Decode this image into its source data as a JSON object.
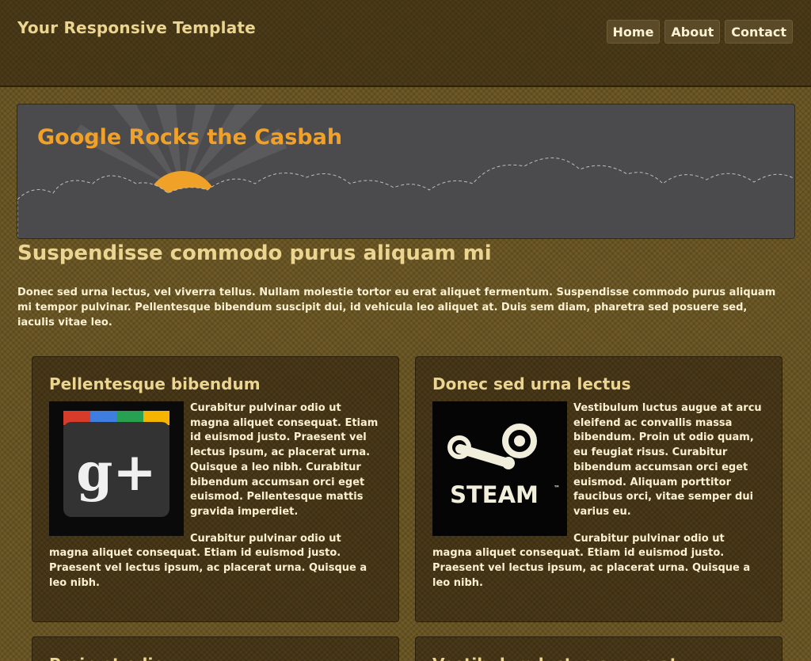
{
  "header": {
    "site_title": "Your Responsive Template",
    "nav": [
      "Home",
      "About",
      "Contact"
    ]
  },
  "banner": {
    "title": "Google Rocks the Casbah",
    "sun_color": "#f0a127",
    "title_color": "#f2a128"
  },
  "main": {
    "heading": "Suspendisse commodo purus aliquam mi",
    "intro": "Donec sed urna lectus, vel viverra tellus. Nullam molestie tortor eu erat aliquet fermentum. Suspendisse commodo purus aliquam mi tempor pulvinar. Pellentesque bibendum suscipit dui, id vehicula leo aliquet at. Duis sem diam, pharetra sed posuere sed, iaculis vitae leo."
  },
  "cards": [
    {
      "title": "Pellentesque bibendum",
      "image": "google-plus-logo",
      "p1": "Curabitur pulvinar odio ut magna aliquet consequat. Etiam id euismod justo. Praesent vel lectus ipsum, ac placerat urna. Quisque a leo nibh. Curabitur bibendum accumsan orci eget euismod. Pellentesque mattis gravida imperdiet.",
      "p2": "Curabitur pulvinar odio ut magna aliquet consequat. Etiam id euismod justo. Praesent vel lectus ipsum, ac placerat urna. Quisque a leo nibh."
    },
    {
      "title": "Donec sed urna lectus",
      "image": "steam-logo",
      "image_text": "STEAM",
      "p1": "Vestibulum luctus augue at arcu eleifend ac convallis massa bibendum. Proin ut odio quam, eu feugiat risus. Curabitur bibendum accumsan orci eget euismod. Aliquam porttitor faucibus orci, vitae semper dui varius eu.",
      "p2": "Curabitur pulvinar odio ut magna aliquet consequat. Etiam id euismod justo. Praesent vel lectus ipsum, ac placerat urna. Quisque a leo nibh."
    },
    {
      "title": "Proin et odio"
    },
    {
      "title": "Vestibulum luctus augue at"
    }
  ]
}
